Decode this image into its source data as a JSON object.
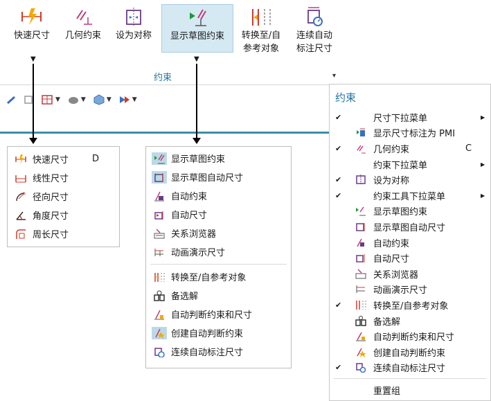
{
  "ribbon": {
    "buttons": [
      {
        "label": "快速尺寸",
        "icon": "smart-dimension-icon"
      },
      {
        "label": "几何约束",
        "icon": "geometric-constraint-icon"
      },
      {
        "label": "设为对称",
        "icon": "make-symmetric-icon"
      },
      {
        "label": "显示草图约束",
        "icon": "show-sketch-constraints-icon"
      },
      {
        "label": "转换至/自\n参考对象",
        "icon": "convert-reference-icon"
      },
      {
        "label": "连续自动\n标注尺寸",
        "icon": "continuous-auto-dimension-icon"
      }
    ],
    "group_label": "约束",
    "group_arrow": "▾"
  },
  "quick_dim_menu": {
    "items": [
      {
        "label": "快速尺寸",
        "shortcut": "D",
        "icon": "quick-dimension-icon"
      },
      {
        "label": "线性尺寸",
        "icon": "linear-dimension-icon"
      },
      {
        "label": "径向尺寸",
        "icon": "radial-dimension-icon"
      },
      {
        "label": "角度尺寸",
        "icon": "angular-dimension-icon"
      },
      {
        "label": "周长尺寸",
        "icon": "perimeter-dimension-icon"
      }
    ]
  },
  "constraint_menu": {
    "items": [
      {
        "label": "显示草图约束",
        "icon": "show-sketch-constraints-icon",
        "highlighted": true
      },
      {
        "label": "显示草图自动尺寸",
        "icon": "show-auto-dimensions-icon",
        "highlighted": true
      },
      {
        "label": "自动约束",
        "icon": "auto-constrain-icon"
      },
      {
        "label": "自动尺寸",
        "icon": "auto-dimension-icon"
      },
      {
        "label": "关系浏览器",
        "icon": "relations-browser-icon"
      },
      {
        "label": "动画演示尺寸",
        "icon": "animate-dimension-icon"
      },
      {
        "label": "转换至/自参考对象",
        "icon": "convert-reference-icon"
      },
      {
        "label": "备选解",
        "icon": "alternate-solution-icon"
      },
      {
        "label": "自动判断约束和尺寸",
        "icon": "inferred-constraints-icon"
      },
      {
        "label": "创建自动判断约束",
        "icon": "create-inferred-constraints-icon",
        "highlighted": true
      },
      {
        "label": "连续自动标注尺寸",
        "icon": "continuous-auto-dimension-icon"
      }
    ]
  },
  "customize_panel": {
    "title": "约束",
    "items": [
      {
        "label": "尺寸下拉菜单",
        "checked": true,
        "submenu": true
      },
      {
        "label": "显示尺寸标注为 PMI",
        "checked": false,
        "icon": "show-pmi-icon"
      },
      {
        "label": "几何约束",
        "checked": true,
        "shortcut": "C",
        "icon": "geometric-constraint-icon"
      },
      {
        "label": "约束下拉菜单",
        "checked": false,
        "submenu": true
      },
      {
        "label": "设为对称",
        "checked": true,
        "icon": "make-symmetric-icon"
      },
      {
        "label": "约束工具下拉菜单",
        "checked": true,
        "submenu": true
      },
      {
        "label": "显示草图约束",
        "checked": false,
        "icon": "show-sketch-constraints-icon"
      },
      {
        "label": "显示草图自动尺寸",
        "checked": false,
        "icon": "show-auto-dimensions-icon"
      },
      {
        "label": "自动约束",
        "checked": false,
        "icon": "auto-constrain-icon"
      },
      {
        "label": "自动尺寸",
        "checked": false,
        "icon": "auto-dimension-icon"
      },
      {
        "label": "关系浏览器",
        "checked": false,
        "icon": "relations-browser-icon"
      },
      {
        "label": "动画演示尺寸",
        "checked": false,
        "icon": "animate-dimension-icon"
      },
      {
        "label": "转换至/自参考对象",
        "checked": true,
        "icon": "convert-reference-icon"
      },
      {
        "label": "备选解",
        "checked": false,
        "icon": "alternate-solution-icon"
      },
      {
        "label": "自动判断约束和尺寸",
        "checked": false,
        "icon": "inferred-constraints-icon"
      },
      {
        "label": "创建自动判断约束",
        "checked": false,
        "icon": "create-inferred-constraints-icon"
      },
      {
        "label": "连续自动标注尺寸",
        "checked": true,
        "icon": "continuous-auto-dimension-icon"
      }
    ],
    "reset_label": "重置组"
  }
}
